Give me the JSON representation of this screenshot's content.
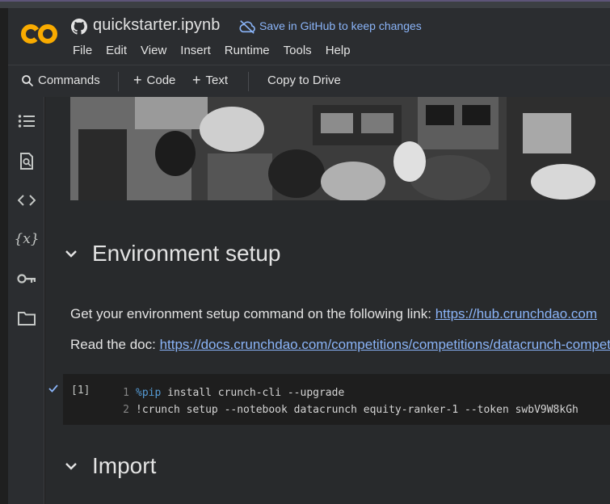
{
  "header": {
    "notebook_title": "quickstarter.ipynb",
    "save_link": "Save in GitHub to keep changes",
    "logo_icon": "colab-logo",
    "colors": {
      "accent": "#f9ab00",
      "link": "#8ab4f8"
    }
  },
  "menu": [
    "File",
    "Edit",
    "View",
    "Insert",
    "Runtime",
    "Tools",
    "Help"
  ],
  "toolbar": {
    "commands": "Commands",
    "add_code": "Code",
    "add_text": "Text",
    "copy_to_drive": "Copy to Drive"
  },
  "sidebar": {
    "icons": [
      "table-of-contents-icon",
      "find-icon",
      "code-snippets-icon",
      "variables-icon",
      "secrets-key-icon",
      "files-folder-icon"
    ]
  },
  "main": {
    "section1_title": "Environment setup",
    "para1_text": "Get your environment setup command on the following link: ",
    "para1_link": "https://hub.crunchdao.com",
    "para2_text": "Read the doc: ",
    "para2_link": "https://docs.crunchdao.com/competitions/competitions/datacrunch-competition",
    "cell": {
      "exec_count": "[1]",
      "line1_num": "1",
      "line1_magic": "%pip",
      "line1_rest": " install crunch-cli --upgrade",
      "line2_num": "2",
      "line2_code": "!crunch setup --notebook datacrunch equity-ranker-1 --token swbV9W8kGh"
    },
    "section2_title": "Import"
  }
}
